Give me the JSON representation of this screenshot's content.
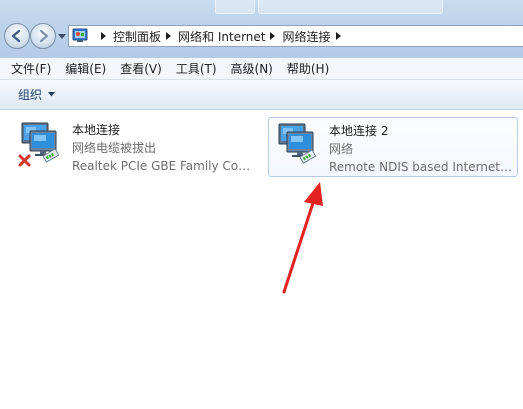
{
  "window": {
    "breadcrumb": [
      "控制面板",
      "网络和 Internet",
      "网络连接"
    ],
    "icons": {
      "back": "back-arrow-icon",
      "forward": "forward-arrow-icon",
      "location": "control-panel-icon"
    }
  },
  "menu": {
    "items": [
      "文件(F)",
      "编辑(E)",
      "查看(V)",
      "工具(T)",
      "高级(N)",
      "帮助(H)"
    ]
  },
  "toolbar": {
    "organize_label": "组织"
  },
  "connections": [
    {
      "name": "本地连接",
      "status": "网络电缆被拔出",
      "device": "Realtek PCIe GBE Family Controller",
      "state": "disconnected",
      "icon": "network-adapter-disconnected-icon"
    },
    {
      "name": "本地连接 2",
      "status": "网络",
      "device": "Remote NDIS based Internet Sharing Device",
      "state": "connected",
      "selected": true,
      "icon": "network-adapter-icon"
    }
  ],
  "colors": {
    "address_gradient": "#bcd3eb",
    "error_red": "#d8342b",
    "annotation_red": "#e42222",
    "selection_border": "#b7cbe3"
  }
}
